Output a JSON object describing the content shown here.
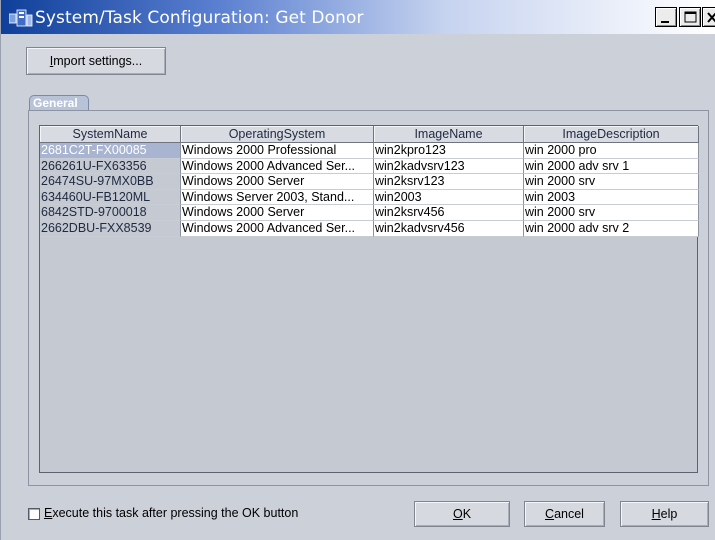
{
  "window": {
    "title": "System/Task Configuration: Get Donor",
    "minimize_glyph": "_",
    "maximize_glyph": "□",
    "close_glyph": "×"
  },
  "toolbar": {
    "import_first": "I",
    "import_rest": "mport settings..."
  },
  "tab": {
    "label": "General"
  },
  "table": {
    "columns": [
      "SystemName",
      "OperatingSystem",
      "ImageName",
      "ImageDescription"
    ],
    "rows": [
      [
        "2681C2T-FX00085",
        "Windows 2000 Professional",
        "win2kpro123",
        "win 2000 pro"
      ],
      [
        "266261U-FX63356",
        "Windows 2000 Advanced Ser...",
        "win2kadvsrv123",
        "win 2000 adv srv 1"
      ],
      [
        "26474SU-97MX0BB",
        "Windows 2000 Server",
        "win2ksrv123",
        "win 2000 srv"
      ],
      [
        "634460U-FB120ML",
        "Windows Server 2003, Stand...",
        "win2003",
        "win 2003"
      ],
      [
        "6842STD-9700018",
        "Windows 2000 Server",
        "win2ksrv456",
        "win 2000 srv"
      ],
      [
        "2662DBU-FXX8539",
        "Windows 2000 Advanced Ser...",
        "win2kadvsrv456",
        "win 2000 adv srv 2"
      ]
    ],
    "selected_row": 0
  },
  "footer": {
    "execute_first": "E",
    "execute_rest": "xecute this task after pressing the OK button",
    "execute_checked": false,
    "ok_first": "O",
    "ok_rest": "K",
    "cancel_first": "C",
    "cancel_rest": "ancel",
    "help_first": "H",
    "help_rest": "elp"
  },
  "colors": {
    "title_gradient_start": "#0f3f9a",
    "window_bg": "#ccd0d8",
    "selection": "#a8b4d0"
  }
}
